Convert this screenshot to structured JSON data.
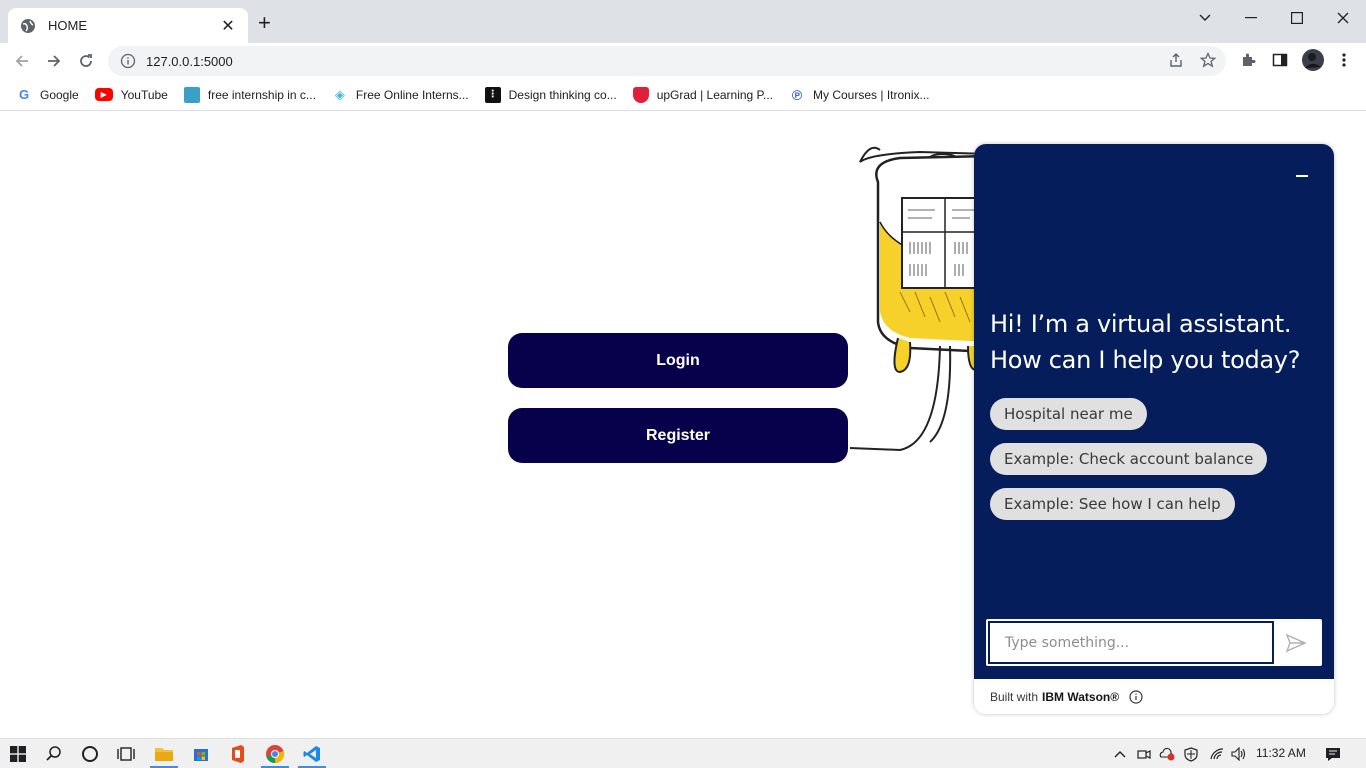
{
  "browser": {
    "tab_title": "HOME",
    "url": "127.0.0.1:5000",
    "bookmarks": [
      {
        "label": "Google",
        "icon": "google-icon",
        "color": "#4285f4"
      },
      {
        "label": "YouTube",
        "icon": "youtube-icon",
        "color": "#ff0000"
      },
      {
        "label": "free internship in c...",
        "icon": "internship-icon",
        "color": "#3aa0c8"
      },
      {
        "label": "Free Online Interns...",
        "icon": "box-icon",
        "color": "#45b8d8"
      },
      {
        "label": "Design thinking co...",
        "icon": "design-icon",
        "color": "#111111"
      },
      {
        "label": "upGrad | Learning P...",
        "icon": "upgrad-icon",
        "color": "#e0203a"
      },
      {
        "label": "My Courses | Itronix...",
        "icon": "itronix-icon",
        "color": "#2a5cc8"
      }
    ]
  },
  "page": {
    "login_label": "Login",
    "register_label": "Register"
  },
  "chat": {
    "greeting": "Hi! I’m a virtual assistant. How can I help you today?",
    "suggestions": [
      "Hospital near me",
      "Example: Check account balance",
      "Example: See how I can help"
    ],
    "input_placeholder": "Type something...",
    "footer_prefix": "Built with",
    "footer_brand": "IBM Watson®",
    "bg_color": "#051e5b"
  },
  "taskbar": {
    "time": "11:32 AM"
  },
  "colors": {
    "button": "#07004a",
    "chat_bg": "#051e5b"
  }
}
